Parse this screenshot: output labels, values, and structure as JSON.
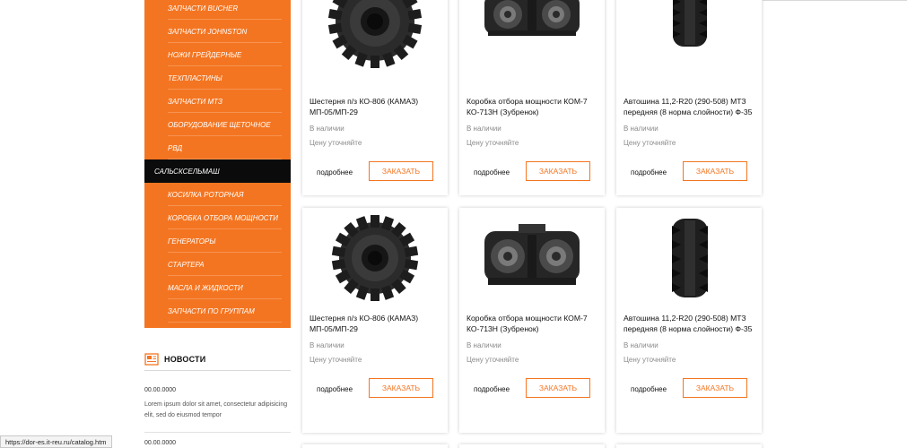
{
  "sidebar": {
    "items": [
      {
        "label": "ЗАПЧАСТИ BUCHER"
      },
      {
        "label": "ЗАПЧАСТИ JOHNSTON"
      },
      {
        "label": "НОЖИ ГРЕЙДЕРНЫЕ"
      },
      {
        "label": "ТЕХПЛАСТИНЫ"
      },
      {
        "label": "ЗАПЧАСТИ МТЗ"
      },
      {
        "label": "ОБОРУДОВАНИЕ ЩЕТОЧНОЕ"
      },
      {
        "label": "РВД"
      },
      {
        "label": "САЛЬСКСЕЛЬМАШ"
      },
      {
        "label": "КОСИЛКА РОТОРНАЯ"
      },
      {
        "label": "КОРОБКА ОТБОРА МОЩНОСТИ"
      },
      {
        "label": "ГЕНЕРАТОРЫ"
      },
      {
        "label": "СТАРТЕРА"
      },
      {
        "label": "МАСЛА И ЖИДКОСТИ"
      },
      {
        "label": "ЗАПЧАСТИ ПО ГРУППАМ"
      }
    ],
    "active_index": 7
  },
  "news": {
    "title": "НОВОСТИ",
    "items": [
      {
        "date": "00.00.0000",
        "text": "Lorem ipsum dolor sit amet, consectetur adipisicing elit, sed do eiusmod tempor"
      },
      {
        "date": "00.00.0000"
      }
    ]
  },
  "products": [
    {
      "image": "gear-icon",
      "title": "Шестерня п/з КО-806 (КАМАЗ) МП-05/МП-29",
      "stock": "В наличии",
      "price": "Цену уточняйте",
      "more": "подробнее",
      "order": "ЗАКАЗАТЬ"
    },
    {
      "image": "gearbox-icon",
      "title": "Коробка отбора мощности КОМ-7 КО-713Н (Зубренок)",
      "stock": "В наличии",
      "price": "Цену уточняйте",
      "more": "подробнее",
      "order": "ЗАКАЗАТЬ"
    },
    {
      "image": "tire-icon",
      "title": "Автошина 11,2-R20 (290-508) МТЗ передняя (8 норма слойности) Ф-35",
      "stock": "В наличии",
      "price": "Цену уточняйте",
      "more": "подробнее",
      "order": "ЗАКАЗАТЬ"
    },
    {
      "image": "gear-icon",
      "title": "Шестерня п/з КО-806 (КАМАЗ) МП-05/МП-29",
      "stock": "В наличии",
      "price": "Цену уточняйте",
      "more": "подробнее",
      "order": "ЗАКАЗАТЬ"
    },
    {
      "image": "gearbox-icon",
      "title": "Коробка отбора мощности КОМ-7 КО-713Н (Зубренок)",
      "stock": "В наличии",
      "price": "Цену уточняйте",
      "more": "подробнее",
      "order": "ЗАКАЗАТЬ"
    },
    {
      "image": "tire-icon",
      "title": "Автошина 11,2-R20 (290-508) МТЗ передняя (8 норма слойности) Ф-35",
      "stock": "В наличии",
      "price": "Цену уточняйте",
      "more": "подробнее",
      "order": "ЗАКАЗАТЬ"
    }
  ],
  "status_url": "https://dor-es.it-reu.ru/catalog.htm",
  "colors": {
    "accent": "#f47521",
    "active": "#0b0b0b"
  }
}
